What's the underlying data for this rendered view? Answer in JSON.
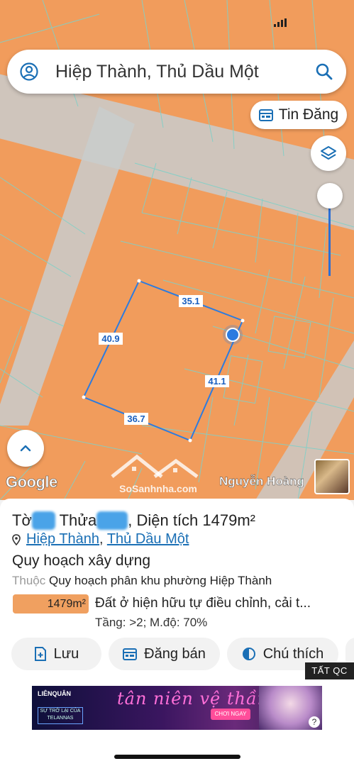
{
  "search": {
    "value": "Hiệp Thành, Thủ Dầu Một"
  },
  "map_controls": {
    "tin_dang_label": "Tin Đăng",
    "google_label": "Google",
    "user_name": "Nguyễn Hoàng",
    "watermark": "SoSanhnha.com"
  },
  "parcel": {
    "edges": [
      "35.1",
      "40.9",
      "41.1",
      "36.7"
    ]
  },
  "panel": {
    "title_prefix": "Tờ",
    "title_mid": "Thửa",
    "title_suffix": ", Diện tích 1479m²",
    "ward": "Hiệp Thành",
    "separator": ",",
    "district": "Thủ Dầu Một",
    "section": "Quy hoạch xây dựng",
    "belong_label": "Thuộc",
    "belong_value": "Quy hoạch phân khu phường Hiệp Thành",
    "zone_area": "1479m²",
    "zone_desc": "Đất ở hiện hữu tự điều chỉnh, cải t...",
    "zone_sub": "Tầng: >2; M.độ: 70%"
  },
  "actions": {
    "save": "Lưu",
    "sell": "Đăng bán",
    "legend": "Chú thích"
  },
  "ad": {
    "close_label": "TẤT QC",
    "brand": "LIÊNQUÂN",
    "hero": "SỰ TRỞ LẠI CỦA TELANNAS",
    "title": "tân niên vệ thần",
    "cta": "CHƠI NGAY",
    "help": "?"
  },
  "colors": {
    "map_bg": "#f19c5c",
    "parcel_line": "#2b7be0",
    "link": "#1a6fb5",
    "zone_chip": "#f0a060"
  }
}
